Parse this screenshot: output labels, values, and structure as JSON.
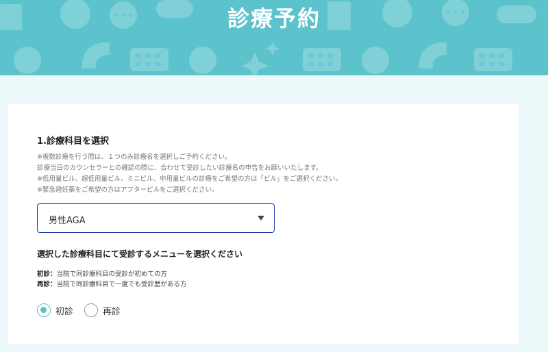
{
  "header": {
    "title": "診療予約"
  },
  "section": {
    "title": "1.診療科目を選択",
    "notes": [
      "※複数診療を行う際は、１つのみ診療名を選択しご予約ください。",
      "診療当日のカウンセラーとの確認の際に、合わせて受診したい診療名の申告をお願いいたします。",
      "※低用量ピル、超低用量ピル、ミニピル、中用量ピルの診療をご希望の方は「ピル」をご選択ください。",
      "※緊急避妊薬をご希望の方はアフターピルをご選択ください。"
    ]
  },
  "select": {
    "value": "男性AGA"
  },
  "menu": {
    "title": "選択した診療科目にて受診するメニューを選択ください",
    "defs": [
      {
        "term": "初診",
        "sep": "：",
        "desc": "当院で同診療科目の受診が初めての方"
      },
      {
        "term": "再診",
        "sep": "：",
        "desc": "当院で同診療科目で一度でも受診歴がある方"
      }
    ],
    "options": [
      {
        "label": "初診",
        "checked": true
      },
      {
        "label": "再診",
        "checked": false
      }
    ]
  },
  "colors": {
    "header_bg": "#5cc3cc",
    "page_bg": "#edf8fb",
    "select_border": "#1f3aa6",
    "radio_accent": "#5cc3cc"
  }
}
